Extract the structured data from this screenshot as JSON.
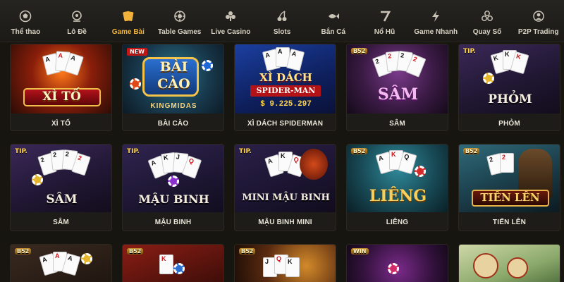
{
  "nav": {
    "items": [
      {
        "label": "Thể thao",
        "icon": "soccer-ball-icon"
      },
      {
        "label": "Lô Đề",
        "icon": "lottery-drum-icon"
      },
      {
        "label": "Game Bài",
        "icon": "playing-cards-icon",
        "active": true
      },
      {
        "label": "Table Games",
        "icon": "poker-chip-icon"
      },
      {
        "label": "Live Casino",
        "icon": "card-suits-icon"
      },
      {
        "label": "Slots",
        "icon": "cherry-icon"
      },
      {
        "label": "Bắn Cá",
        "icon": "fish-icon"
      },
      {
        "label": "Nổ Hũ",
        "icon": "seven-icon"
      },
      {
        "label": "Game Nhanh",
        "icon": "lightning-icon"
      },
      {
        "label": "Quay Số",
        "icon": "lottery-balls-icon"
      },
      {
        "label": "P2P Trading",
        "icon": "p2p-users-icon"
      }
    ]
  },
  "games": [
    {
      "name": "XÌ TỐ",
      "art_title": "XÌ TỐ",
      "badge": ""
    },
    {
      "name": "BÀI CÀO",
      "art_title": "BÀI CÀO",
      "art_sub": "KINGMIDAS",
      "badge": "NEW"
    },
    {
      "name": "XÌ DÁCH SPIDERMAN",
      "art_title": "XÌ DÁCH",
      "art_sub": "SPIDER-MAN",
      "art_amount": "$ 9.225.297",
      "badge": ""
    },
    {
      "name": "SÂM",
      "art_title": "SÂM",
      "badge": "B52"
    },
    {
      "name": "PHỎM",
      "art_title": "PHỎM",
      "badge": "TIP."
    },
    {
      "name": "SÂM",
      "art_title": "SÂM",
      "badge": "TIP."
    },
    {
      "name": "MẬU BINH",
      "art_title": "MẬU BINH",
      "badge": "TIP."
    },
    {
      "name": "MẬU BINH MINI",
      "art_title": "MINI MẬU BINH",
      "badge": "TIP."
    },
    {
      "name": "LIÊNG",
      "art_title": "LIÊNG",
      "badge": "B52"
    },
    {
      "name": "TIẾN LÊN",
      "art_title": "TIẾN LÊN",
      "badge": "B52"
    },
    {
      "name": "",
      "badge": "B52"
    },
    {
      "name": "",
      "badge": "B52"
    },
    {
      "name": "",
      "badge": "B52"
    },
    {
      "name": "",
      "badge": "WIN"
    },
    {
      "name": "",
      "badge": ""
    }
  ],
  "colors": {
    "accent": "#f0b23a",
    "nav_bg": "#262420",
    "page_bg": "#17150f",
    "text": "#e9e4d8"
  }
}
